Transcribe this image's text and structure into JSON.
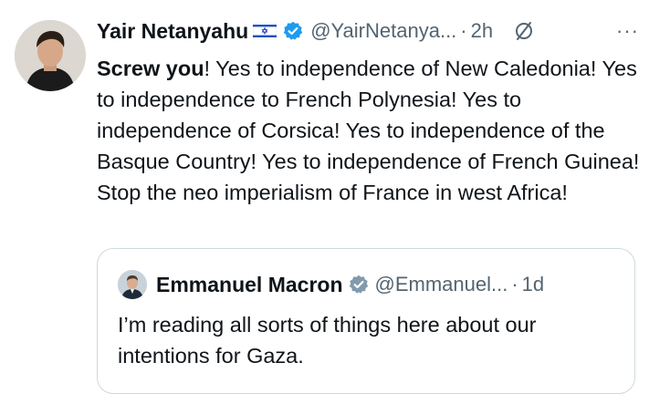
{
  "tweet": {
    "author_name": "Yair Netanyahu",
    "author_flag": "israel-flag-icon",
    "handle": "@YairNetanya...",
    "separator": "·",
    "time": "2h",
    "more": "···",
    "text_bold": "Screw you",
    "text_rest": "! Yes to independence of New Caledonia! Yes to independence to French Polynesia! Yes to independence of Corsica! Yes to independence of the Basque Country! Yes to independence of French Guinea! Stop the neo imperialism of France in west Africa!"
  },
  "quoted": {
    "author_name": "Emmanuel Macron",
    "handle": "@Emmanuel...",
    "separator": "·",
    "time": "1d",
    "text": "I’m reading all sorts of things here about our intentions for Gaza."
  },
  "colors": {
    "verified_blue": "#1d9bf0",
    "secondary_text": "#536471",
    "border": "#cfd9de"
  }
}
